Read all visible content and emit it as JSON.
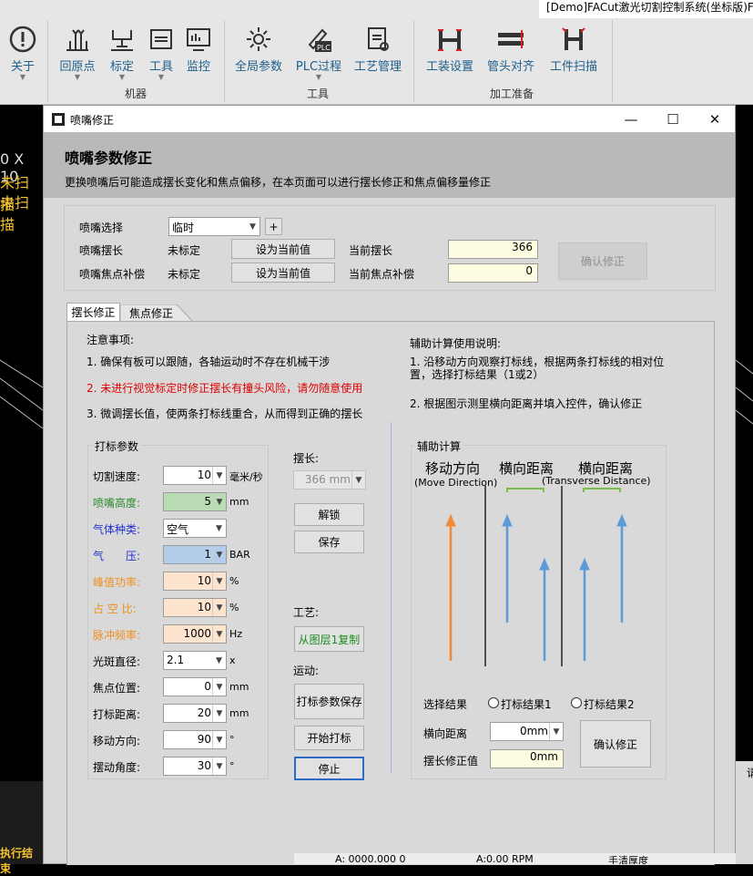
{
  "window_title": "[Demo]FACut激光切割控制系统(坐标版)F",
  "ribbon": {
    "buttons": [
      {
        "label": "关于"
      },
      {
        "label": "回原点"
      },
      {
        "label": "标定"
      },
      {
        "label": "工具"
      },
      {
        "label": "监控"
      },
      {
        "label": "全局参数"
      },
      {
        "label": "PLC过程"
      },
      {
        "label": "工艺管理"
      },
      {
        "label": "工装设置"
      },
      {
        "label": "管头对齐"
      },
      {
        "label": "工件扫描"
      }
    ],
    "groups": [
      {
        "label": "机器"
      },
      {
        "label": "工具"
      },
      {
        "label": "加工准备"
      }
    ]
  },
  "background_text": {
    "line1": "0 X 10",
    "line2": "未扫描",
    "line3": "未扫描",
    "bottom_left": "执行结束",
    "status_a": "A: 0000.000 0",
    "status_b": "A:0.00 RPM",
    "status_c": "手清厚度",
    "right_edge": "请"
  },
  "dialog": {
    "title": "喷嘴修正",
    "controls": {
      "minimize": "—",
      "maximize": "☐",
      "close": "✕"
    },
    "header_title": "喷嘴参数修正",
    "header_desc": "更换喷嘴后可能造成摆长变化和焦点偏移，在本页面可以进行摆长修正和焦点偏移量修正",
    "nozzle": {
      "select_label": "喷嘴选择",
      "select_value": "临时",
      "add_label": "+",
      "length_label": "喷嘴摆长",
      "length_status": "未标定",
      "set_current_1": "设为当前值",
      "current_length_label": "当前摆长",
      "current_length_value": "366",
      "focus_label": "喷嘴焦点补偿",
      "focus_status": "未标定",
      "set_current_2": "设为当前值",
      "current_focus_label": "当前焦点补偿",
      "current_focus_value": "0",
      "confirm_label": "确认修正"
    },
    "tabs": [
      {
        "label": "摆长修正"
      },
      {
        "label": "焦点修正"
      }
    ],
    "notes": {
      "title": "注意事项:",
      "n1": "1. 确保有板可以跟随，各轴运动时不存在机械干涉",
      "n2": "2. 未进行视觉标定时修正摆长有撞头风险，请勿随意使用",
      "n3": "3. 微调摆长值，使两条打标线重合，从而得到正确的摆长"
    },
    "params": {
      "legend": "打标参数",
      "rows": [
        {
          "label": "切割速度:",
          "value": "10",
          "unit": "毫米/秒",
          "color": "#000000",
          "bg": "#ffffff"
        },
        {
          "label": "喷嘴高度:",
          "value": "5",
          "unit": "mm",
          "color": "#2e8b2e",
          "bg": "#b9dcb5"
        },
        {
          "label": "气体种类:",
          "value": "空气",
          "unit": "",
          "color": "#1f2fd0",
          "bg": "#ffffff"
        },
        {
          "label": "气　　压:",
          "value": "1",
          "unit": "BAR",
          "color": "#1f2fd0",
          "bg": "#b3cdea"
        },
        {
          "label": "峰值功率:",
          "value": "10",
          "unit": "%",
          "color": "#f0901e",
          "bg": "#fde4cf"
        },
        {
          "label": "占 空 比:",
          "value": "10",
          "unit": "%",
          "color": "#f0901e",
          "bg": "#fde4cf"
        },
        {
          "label": "脉冲频率:",
          "value": "1000",
          "unit": "Hz",
          "color": "#f0901e",
          "bg": "#fde4cf"
        },
        {
          "label": "光斑直径:",
          "value": "2.1",
          "unit": "x",
          "color": "#000000",
          "bg": "#ffffff"
        },
        {
          "label": "焦点位置:",
          "value": "0",
          "unit": "mm",
          "color": "#000000",
          "bg": "#ffffff"
        },
        {
          "label": "打标距离:",
          "value": "20",
          "unit": "mm",
          "color": "#000000",
          "bg": "#ffffff"
        },
        {
          "label": "移动方向:",
          "value": "90",
          "unit": "°",
          "color": "#000000",
          "bg": "#ffffff"
        },
        {
          "label": "摆动角度:",
          "value": "30",
          "unit": "°",
          "color": "#000000",
          "bg": "#ffffff"
        }
      ]
    },
    "pendulum": {
      "label": "摆长:",
      "value": "366 mm",
      "unlock": "解锁",
      "save": "保存"
    },
    "process": {
      "label": "工艺:",
      "copy_from_layer": "从图层1复制"
    },
    "motion": {
      "label": "运动:",
      "save_params": "打标参数保存",
      "start_mark": "开始打标",
      "stop": "停止"
    },
    "helper": {
      "title": "辅助计算使用说明:",
      "h1": "1. 沿移动方向观察打标线，根据两条打标线的相对位置，选择打标结果（1或2）",
      "h2": "2. 根据图示测里横向距离并填入控件，确认修正"
    },
    "calc": {
      "legend": "辅助计算",
      "move_dir_cn": "移动方向",
      "move_dir_en": "(Move Direction)",
      "trans_cn_1": "横向距离",
      "trans_cn_2": "横向距离",
      "trans_en": "(Transverse Distance)",
      "select_result": "选择结果",
      "result1": "打标结果1",
      "result2": "打标结果2",
      "trans_label": "横向距离",
      "trans_value": "0mm",
      "correct_label": "摆长修正值",
      "correct_value": "0mm",
      "confirm": "确认修正"
    }
  },
  "colors": {
    "accent_blue": "#1f5f8b",
    "arrow_orange": "#ee8a3c",
    "arrow_blue": "#5d9ad8",
    "bracket_green": "#7cbd4a",
    "warning_red": "#e00000",
    "yellow_input": "#fffde1"
  }
}
